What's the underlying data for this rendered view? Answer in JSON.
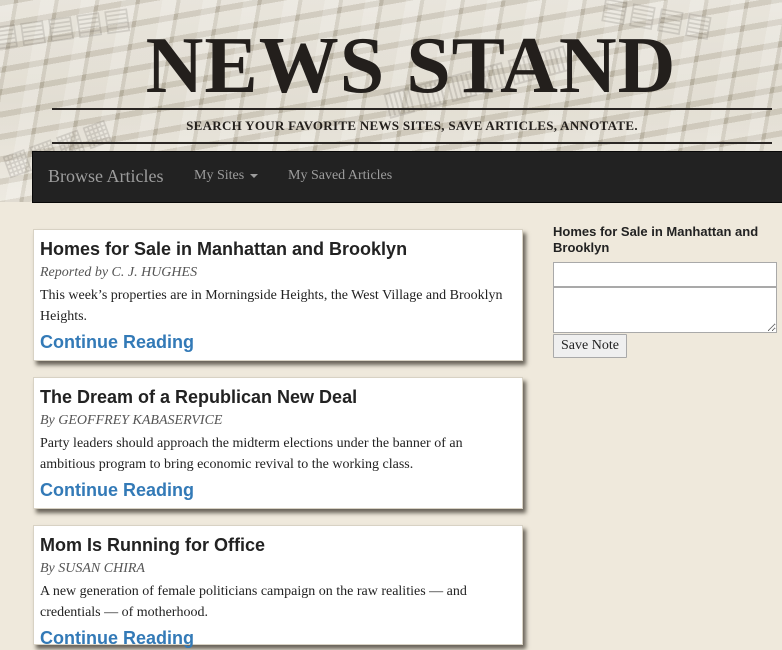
{
  "header": {
    "title": "NEWS STAND",
    "tagline": "SEARCH YOUR FAVORITE NEWS SITES, SAVE ARTICLES, ANNOTATE."
  },
  "navbar": {
    "brand": "Browse Articles",
    "my_sites": "My Sites",
    "saved_articles": "My Saved Articles"
  },
  "articles": [
    {
      "title": "Homes for Sale in Manhattan and Brooklyn",
      "byline": "Reported by C. J. HUGHES",
      "summary": "This week’s properties are in Morningside Heights, the West Village and Brooklyn Heights.",
      "link": "Continue Reading"
    },
    {
      "title": "The Dream of a Republican New Deal",
      "byline": "By GEOFFREY KABASERVICE",
      "summary": "Party leaders should approach the midterm elections under the banner of an ambitious program to bring economic revival to the working class.",
      "link": "Continue Reading"
    },
    {
      "title": "Mom Is Running for Office",
      "byline": "By SUSAN CHIRA",
      "summary": "A new generation of female politicians campaign on the raw realities — and credentials — of motherhood.",
      "link": "Continue Reading"
    }
  ],
  "note_panel": {
    "heading": "Homes for Sale in Manhattan and Brooklyn",
    "title_value": "",
    "body_value": "",
    "save_label": "Save Note"
  }
}
